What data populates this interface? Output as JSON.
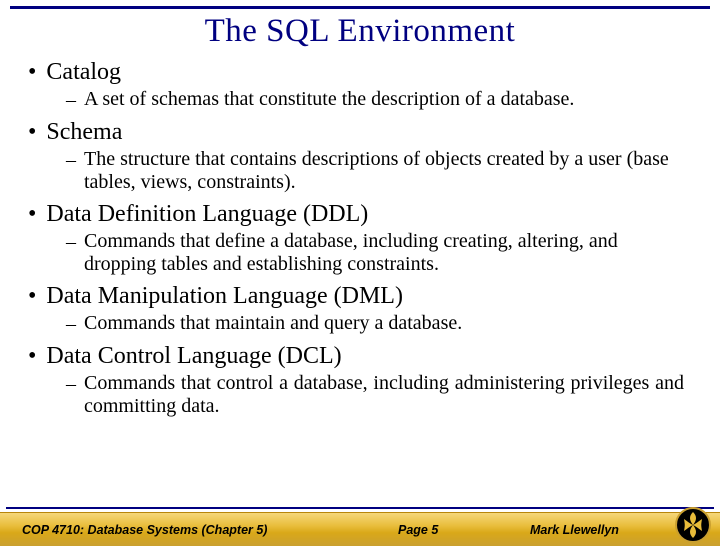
{
  "title": "The SQL Environment",
  "items": [
    {
      "heading": "Catalog",
      "sub": "A set of schemas that constitute the description of a database.",
      "justify": false
    },
    {
      "heading": "Schema",
      "sub": "The structure that contains descriptions of objects created by a user (base tables, views, constraints).",
      "justify": false
    },
    {
      "heading": "Data Definition Language (DDL)",
      "sub": "Commands that define a database, including creating, altering, and dropping tables and establishing constraints.",
      "justify": false
    },
    {
      "heading": "Data Manipulation Language (DML)",
      "sub": "Commands that maintain and query a database.",
      "justify": false
    },
    {
      "heading": "Data Control Language (DCL)",
      "sub": "Commands that control a database, including administering privileges and committing data.",
      "justify": true
    }
  ],
  "footer": {
    "course": "COP 4710: Database Systems  (Chapter 5)",
    "page": "Page 5",
    "author": "Mark Llewellyn"
  }
}
